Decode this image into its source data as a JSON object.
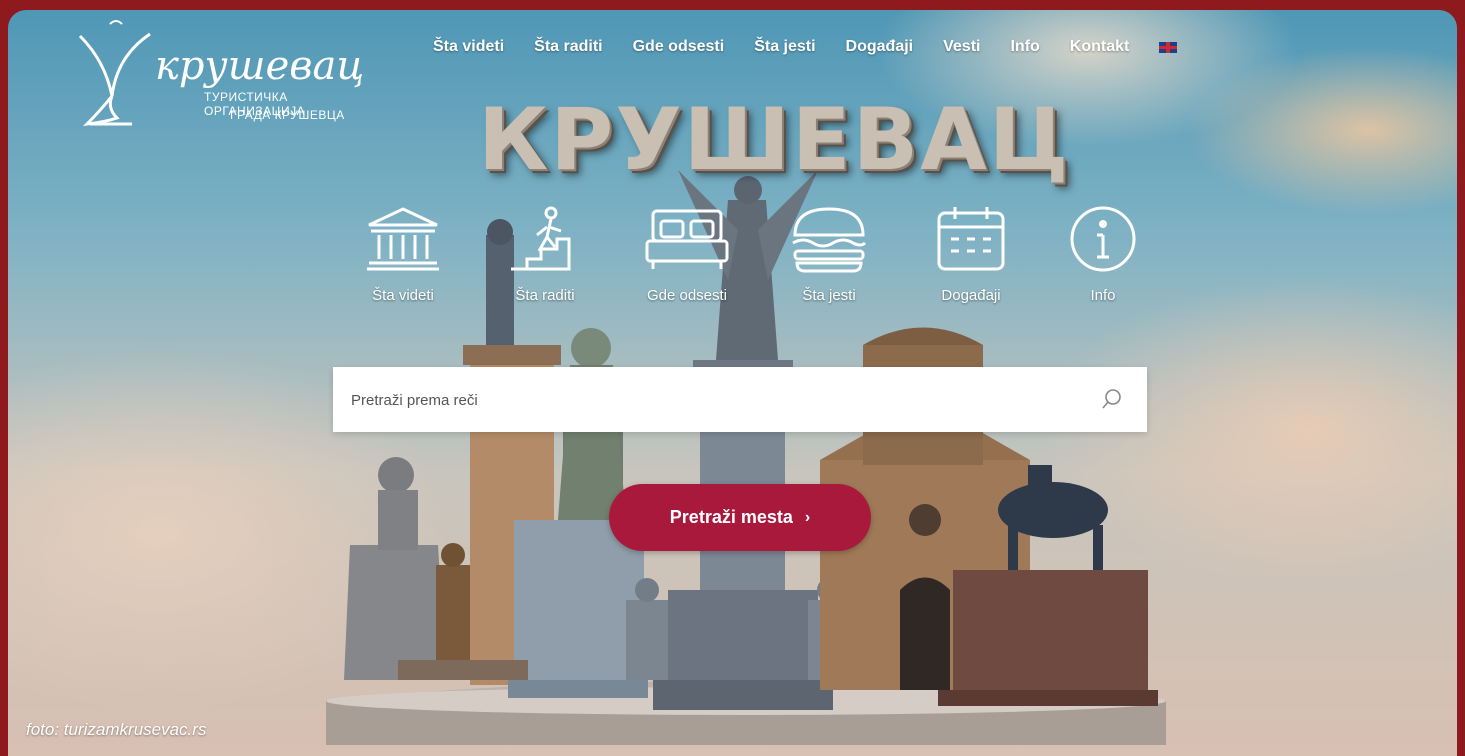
{
  "logo": {
    "script": "крушевац",
    "line1": "ТУРИСТИЧКА ОРГАНИЗАЦИЈА",
    "line2": "ГРАДА КРУШЕВЦА"
  },
  "nav": {
    "items": [
      "Šta videti",
      "Šta raditi",
      "Gde odsesti",
      "Šta jesti",
      "Događaji",
      "Vesti",
      "Info",
      "Kontakt"
    ],
    "language_flag": "uk-flag-icon"
  },
  "hero": {
    "title": "КРУШЕВАЦ"
  },
  "categories": [
    {
      "label": "Šta videti",
      "icon": "museum-icon"
    },
    {
      "label": "Šta raditi",
      "icon": "hiking-icon"
    },
    {
      "label": "Gde odsesti",
      "icon": "bed-icon"
    },
    {
      "label": "Šta jesti",
      "icon": "burger-icon"
    },
    {
      "label": "Događaji",
      "icon": "calendar-icon"
    },
    {
      "label": "Info",
      "icon": "info-icon"
    }
  ],
  "search": {
    "placeholder": "Pretraži prema reči",
    "icon": "search-icon"
  },
  "cta": {
    "label": "Pretraži mesta",
    "arrow": "›"
  },
  "credit": "foto: turizamkrusevac.rs",
  "colors": {
    "frame": "#8e1a1e",
    "cta": "#a9193c",
    "text": "#ffffff"
  }
}
